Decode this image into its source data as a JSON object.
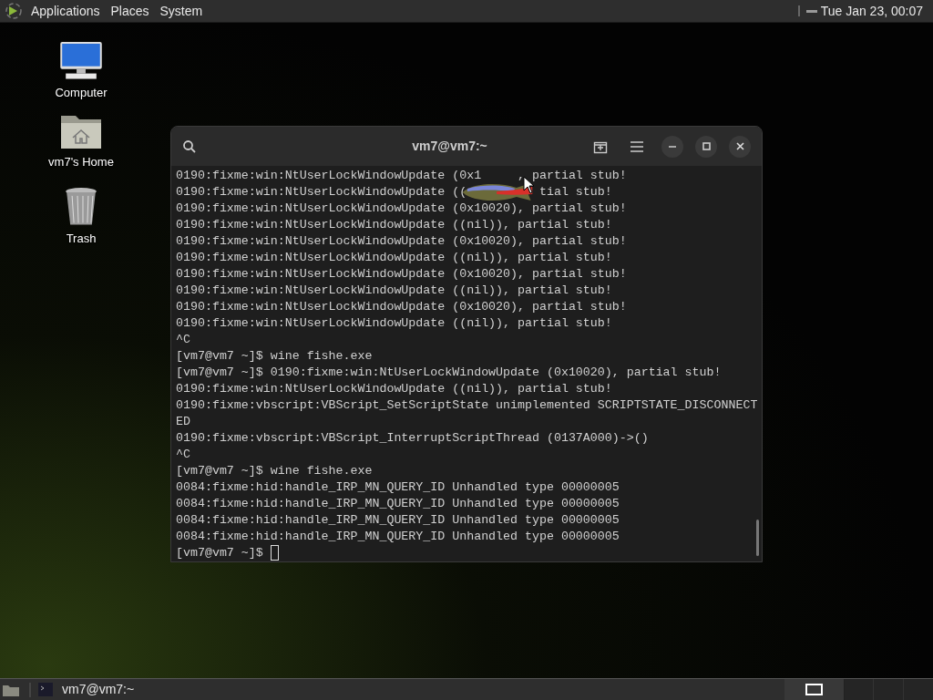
{
  "top_panel": {
    "menus": [
      "Applications",
      "Places",
      "System"
    ],
    "clock": "Tue Jan 23, 00:07"
  },
  "desktop_icons": [
    {
      "kind": "computer",
      "label": "Computer"
    },
    {
      "kind": "home",
      "label": "vm7's Home"
    },
    {
      "kind": "trash",
      "label": "Trash"
    }
  ],
  "terminal": {
    "title": "vm7@vm7:~",
    "lines": [
      {
        "segments": [
          "0190:fixme:win:NtUserLockWindowUpdate (0x1",
          ", partial stub!"
        ]
      },
      {
        "segments": [
          "0190:fixme:win:NtUserLockWindowUpdate ((",
          "tial stub!"
        ]
      },
      {
        "segments": [
          "0190:fixme:win:NtUserLockWindowUpdate (0x10020), partial stub!"
        ]
      },
      {
        "segments": [
          "0190:fixme:win:NtUserLockWindowUpdate ((nil)), partial stub!"
        ]
      },
      {
        "segments": [
          "0190:fixme:win:NtUserLockWindowUpdate (0x10020), partial stub!"
        ]
      },
      {
        "segments": [
          "0190:fixme:win:NtUserLockWindowUpdate ((nil)), partial stub!"
        ]
      },
      {
        "segments": [
          "0190:fixme:win:NtUserLockWindowUpdate (0x10020), partial stub!"
        ]
      },
      {
        "segments": [
          "0190:fixme:win:NtUserLockWindowUpdate ((nil)), partial stub!"
        ]
      },
      {
        "segments": [
          "0190:fixme:win:NtUserLockWindowUpdate (0x10020), partial stub!"
        ]
      },
      {
        "segments": [
          "0190:fixme:win:NtUserLockWindowUpdate ((nil)), partial stub!"
        ]
      },
      {
        "segments": [
          "^C"
        ]
      },
      {
        "segments": [
          "[vm7@vm7 ~]$ wine fishe.exe"
        ]
      },
      {
        "segments": [
          "[vm7@vm7 ~]$ 0190:fixme:win:NtUserLockWindowUpdate (0x10020), partial stub!"
        ]
      },
      {
        "segments": [
          "0190:fixme:win:NtUserLockWindowUpdate ((nil)), partial stub!"
        ]
      },
      {
        "segments": [
          "0190:fixme:vbscript:VBScript_SetScriptState unimplemented SCRIPTSTATE_DISCONNECT"
        ]
      },
      {
        "segments": [
          "ED"
        ]
      },
      {
        "segments": [
          "0190:fixme:vbscript:VBScript_InterruptScriptThread (0137A000)->()"
        ]
      },
      {
        "segments": [
          "^C"
        ]
      },
      {
        "segments": [
          "[vm7@vm7 ~]$ wine fishe.exe"
        ]
      },
      {
        "segments": [
          "0084:fixme:hid:handle_IRP_MN_QUERY_ID Unhandled type 00000005"
        ]
      },
      {
        "segments": [
          "0084:fixme:hid:handle_IRP_MN_QUERY_ID Unhandled type 00000005"
        ]
      },
      {
        "segments": [
          "0084:fixme:hid:handle_IRP_MN_QUERY_ID Unhandled type 00000005"
        ]
      },
      {
        "segments": [
          "0084:fixme:hid:handle_IRP_MN_QUERY_ID Unhandled type 00000005"
        ]
      },
      {
        "segments": [
          "[vm7@vm7 ~]$ "
        ],
        "cursor": true
      }
    ]
  },
  "taskbar": {
    "windows": [
      {
        "title": "vm7@vm7:~",
        "selected": false
      }
    ]
  }
}
